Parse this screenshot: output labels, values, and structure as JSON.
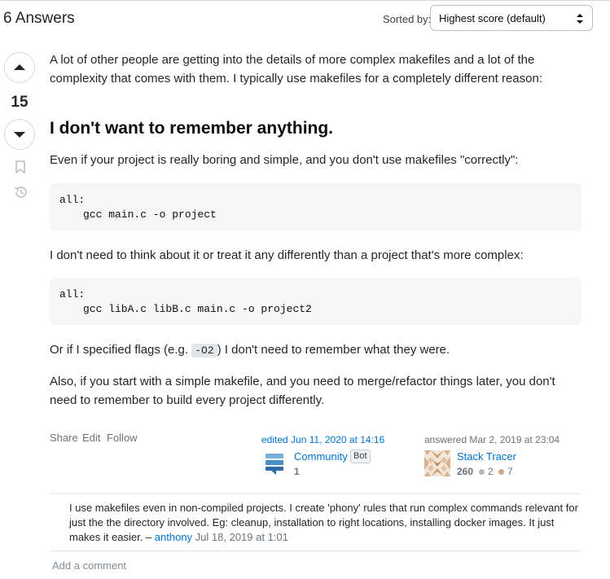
{
  "header": {
    "answers_count": "6 Answers",
    "sorted_label": "Sorted by:",
    "sort_value": "Highest score (default)"
  },
  "vote": {
    "score": "15"
  },
  "post": {
    "p1": "A lot of other people are getting into the details of more complex makefiles and a lot of the complexity that comes with them. I typically use makefiles for a completely different reason:",
    "heading": "I don't want to remember anything.",
    "p2": "Even if your project is really boring and simple, and you don't use makefiles \"correctly\":",
    "code1": [
      "all:",
      "gcc main.c -o project"
    ],
    "p3": "I don't need to think about it or treat it any differently than a project that's more complex:",
    "code2": [
      "all:",
      "gcc libA.c libB.c main.c -o project2"
    ],
    "p4_before": "Or if I specified flags (e.g. ",
    "p4_code": "-O2",
    "p4_after": ") I don't need to remember what they were.",
    "p5": "Also, if you start with a simple makefile, and you need to merge/refactor things later, you don't need to remember to build every project differently."
  },
  "meta": {
    "share": "Share",
    "edit": "Edit",
    "follow": "Follow",
    "edited": "edited Jun 11, 2020 at 14:16",
    "editor_name": "Community",
    "editor_badge": "Bot",
    "editor_rep": "1",
    "answered": "answered Mar 2, 2019 at 23:04",
    "author_name": "Stack Tracer",
    "author_rep": "260",
    "silver_count": "2",
    "bronze_count": "7"
  },
  "comment": {
    "text": "I use makefiles even in non-compiled projects. I create 'phony' rules that run complex commands relevant for just the the directory involved. Eg: cleanup, installation to right locations, installing docker images. It just makes it easier. – ",
    "user": "anthony",
    "date": "Jul 18, 2019 at 1:01",
    "add_comment": "Add a comment"
  },
  "colors": {
    "link": "#0074cc",
    "silver": "#b4b8bc",
    "bronze": "#d1a684"
  }
}
